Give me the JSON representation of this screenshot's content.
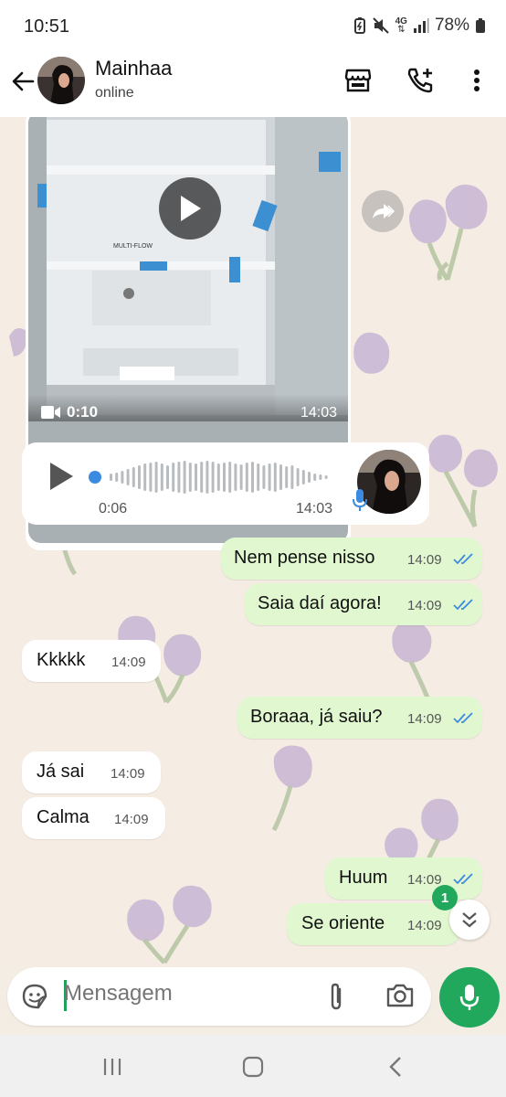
{
  "status_bar": {
    "time": "10:51",
    "network": "4G",
    "battery": "78%"
  },
  "header": {
    "contact_name": "Mainhaa",
    "contact_status": "online"
  },
  "video_message": {
    "duration": "0:10",
    "time": "14:03",
    "label": "MULTI-FLOW"
  },
  "voice_message": {
    "duration": "0:06",
    "time": "14:03"
  },
  "messages": [
    {
      "direction": "out",
      "text": "Nem pense nisso",
      "time": "14:09"
    },
    {
      "direction": "out",
      "text": "Saia daí agora!",
      "time": "14:09"
    },
    {
      "direction": "in",
      "text": "Kkkkk",
      "time": "14:09"
    },
    {
      "direction": "out",
      "text": "Boraaa, já saiu?",
      "time": "14:09"
    },
    {
      "direction": "in",
      "text": "Já sai",
      "time": "14:09"
    },
    {
      "direction": "in",
      "text": "Calma",
      "time": "14:09"
    },
    {
      "direction": "out",
      "text": "Huum",
      "time": "14:09"
    },
    {
      "direction": "out",
      "text": "Se oriente",
      "time": "14:09"
    }
  ],
  "unread_count": "1",
  "composer": {
    "placeholder": "Mensagem"
  },
  "colors": {
    "accent_green": "#21a85d",
    "outgoing_bubble": "#e1f7d0",
    "tick_blue": "#3b8be0",
    "chat_bg": "#f5ece3"
  },
  "icons": [
    "back-arrow-icon",
    "shop-icon",
    "add-call-icon",
    "more-options-icon",
    "play-icon",
    "video-camera-icon",
    "forward-icon",
    "mic-icon",
    "sticker-icon",
    "attach-icon",
    "camera-icon",
    "double-chevron-down-icon",
    "recents-icon",
    "home-icon",
    "nav-back-icon"
  ]
}
